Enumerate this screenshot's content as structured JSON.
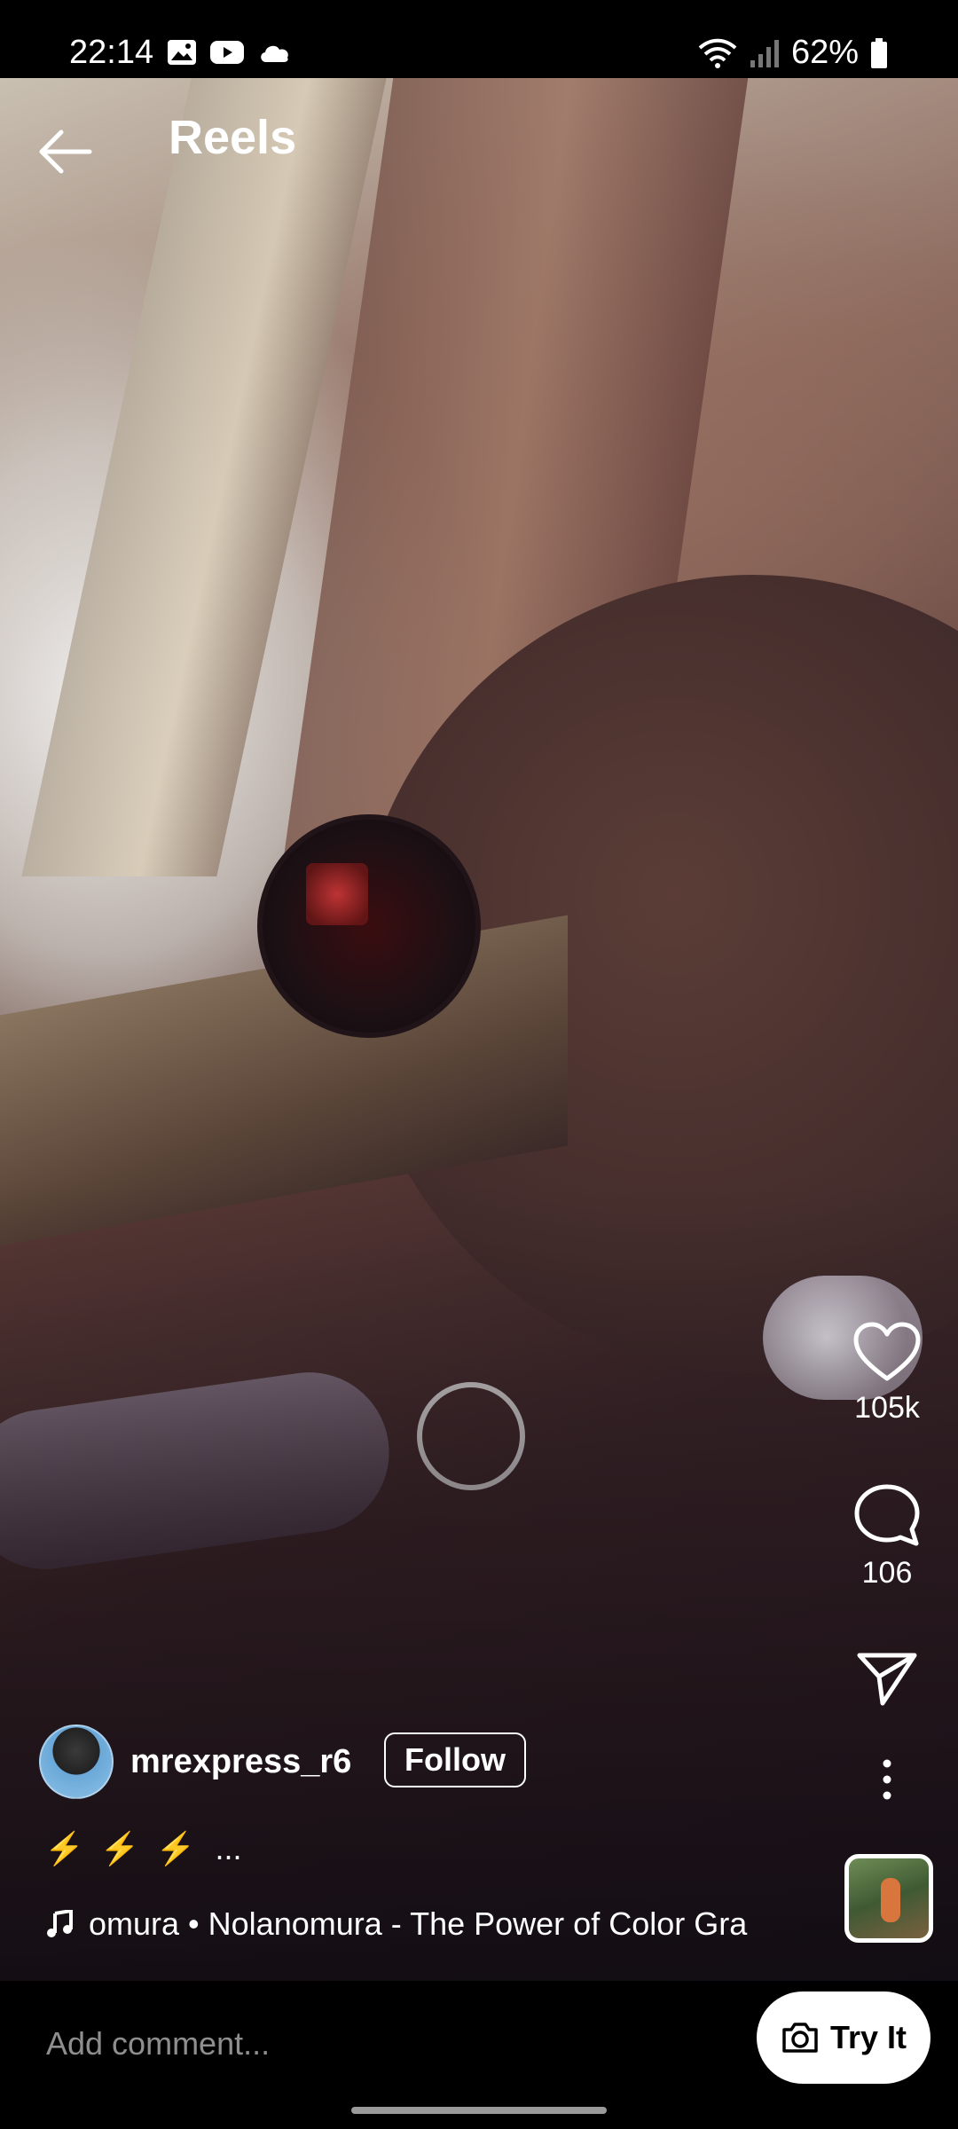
{
  "status_bar": {
    "time": "22:14",
    "battery": "62%",
    "icons_left": [
      "gallery-icon",
      "youtube-icon",
      "cloud-icon"
    ],
    "icons_right": [
      "wifi-icon",
      "signal-icon",
      "battery-icon"
    ]
  },
  "header": {
    "title": "Reels",
    "back_icon": "arrow-left-icon"
  },
  "actions": {
    "likes": "105k",
    "comments": "106"
  },
  "post": {
    "username": "mrexpress_r6",
    "follow_label": "Follow",
    "caption": "⚡ ⚡ ⚡",
    "caption_more": "...",
    "music": "omura • Nolanomura - The Power of Color Gra"
  },
  "comment_bar": {
    "placeholder": "Add comment...",
    "try_label": "Try It"
  },
  "colors": {
    "background": "#000000",
    "text": "#ffffff",
    "placeholder": "#8e8e8e",
    "caption_bolts": "#f5c518"
  }
}
